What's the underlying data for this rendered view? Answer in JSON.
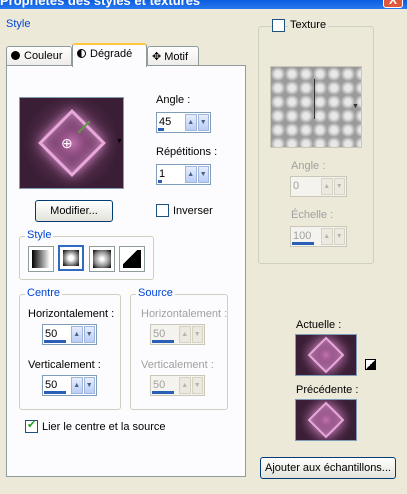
{
  "window": {
    "title": "Propriétés des styles et textures",
    "close_glyph": "X"
  },
  "style_group": {
    "title": "Style"
  },
  "tabs": [
    {
      "label": "Couleur"
    },
    {
      "label": "Dégradé"
    },
    {
      "label": "Motif"
    }
  ],
  "gradient": {
    "angle_label": "Angle :",
    "angle_value": "45",
    "repetitions_label": "Répétitions :",
    "repetitions_value": "1",
    "modify_button": "Modifier...",
    "invert_label": "Inverser",
    "style_title": "Style",
    "centre": {
      "title": "Centre",
      "horizontal_label": "Horizontalement :",
      "horizontal_value": "50",
      "vertical_label": "Verticalement :",
      "vertical_value": "50"
    },
    "source": {
      "title": "Source",
      "horizontal_label": "Horizontalement :",
      "horizontal_value": "50",
      "vertical_label": "Verticalement :",
      "vertical_value": "50"
    },
    "link_label": "Lier le centre et la source"
  },
  "texture": {
    "label": "Texture",
    "angle_label": "Angle :",
    "angle_value": "0",
    "scale_label": "Échelle :",
    "scale_value": "100"
  },
  "current_label": "Actuelle :",
  "previous_label": "Précédente :",
  "add_swatch_button": "Ajouter aux échantillons...",
  "colors": {
    "accent": "#316ac5",
    "group_title": "#0046d5",
    "gradient_pink": "#e8a8da"
  }
}
